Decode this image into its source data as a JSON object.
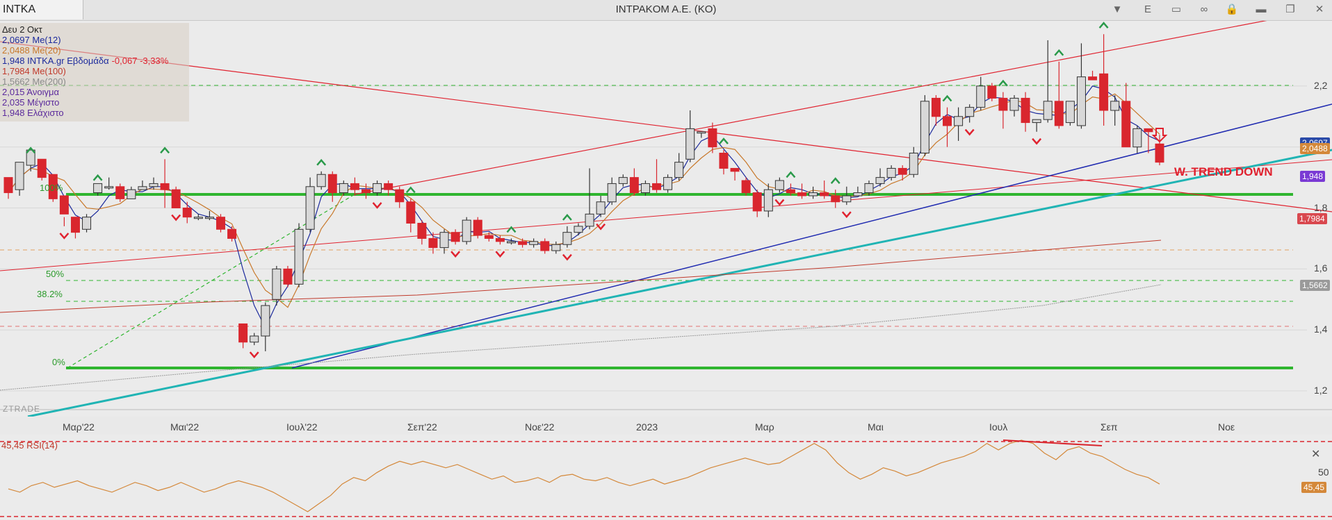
{
  "header": {
    "symbol": "INTKA",
    "title": "INTPAKOM A.E. (KO)",
    "period_button": "E"
  },
  "info": {
    "date": "Δευ 2 Οκτ",
    "lines": [
      {
        "text": "2,0697 Me(12)",
        "color": "#1c2a9c"
      },
      {
        "text": "2,0488 Me(20)",
        "color": "#c8782a"
      },
      {
        "text": "1,948 INTKA.gr Εβδομάδα",
        "color": "#1c2a9c",
        "extra": "-0,067 -3,33%",
        "extra_color": "#e0222f"
      },
      {
        "text": "1,7984 Me(100)",
        "color": "#c0392b"
      },
      {
        "text": "1,5662 Me(200)",
        "color": "#8a8a8a"
      },
      {
        "text": "2,015 Άνοιγμα",
        "color": "#5b2a9c"
      },
      {
        "text": "2,035 Μέγιστο",
        "color": "#5b2a9c"
      },
      {
        "text": "1,948 Ελάχιστο",
        "color": "#5b2a9c"
      }
    ]
  },
  "axis": {
    "x_ticks": [
      "Μαρ'22",
      "Μαι'22",
      "Ιουλ'22",
      "Σεπ'22",
      "Νοε'22",
      "2023",
      "Μαρ",
      "Μαι",
      "Ιουλ",
      "Σεπ",
      "Νοε"
    ],
    "y_ticks": [
      "2,2",
      "2",
      "1,8",
      "1,6",
      "1,4",
      "1,2"
    ],
    "rsi_tick": "50"
  },
  "price_tags": [
    {
      "text": "2,0697",
      "color": "#2a4aa8"
    },
    {
      "text": "2,0488",
      "color": "#d4883a"
    },
    {
      "text": "1,948",
      "color": "#7a3ad4"
    },
    {
      "text": "1,7984",
      "color": "#d9484f"
    },
    {
      "text": "1,5662",
      "color": "#9a9a9a"
    }
  ],
  "fib": [
    "100%",
    "50%",
    "38.2%",
    "0%"
  ],
  "annotation": "W. TREND DOWN",
  "watermark": "ZTRADE",
  "rsi": {
    "label": "45,45 RSI(14)",
    "value_tag": "45,45",
    "values": [
      42,
      40,
      44,
      46,
      43,
      45,
      47,
      44,
      42,
      40,
      43,
      46,
      44,
      41,
      43,
      46,
      43,
      40,
      42,
      45,
      47,
      45,
      43,
      40,
      36,
      32,
      28,
      33,
      38,
      45,
      49,
      47,
      52,
      56,
      59,
      57,
      59,
      57,
      55,
      57,
      54,
      51,
      48,
      50,
      46,
      47,
      49,
      46,
      50,
      51,
      48,
      47,
      49,
      46,
      44,
      46,
      48,
      45,
      47,
      49,
      52,
      55,
      57,
      59,
      61,
      59,
      57,
      58,
      62,
      66,
      70,
      66,
      58,
      52,
      48,
      51,
      55,
      53,
      50,
      52,
      55,
      58,
      60,
      62,
      65,
      70,
      66,
      70,
      72,
      70,
      64,
      60,
      66,
      68,
      64,
      62,
      58,
      54,
      51,
      49,
      45
    ]
  },
  "colors": {
    "bull": "#d8d8d8",
    "bear": "#d9262e",
    "ma12": "#1c2a9c",
    "ma20": "#c8782a",
    "ma100": "#c0392b",
    "ma200": "#9a9a9a",
    "fib": "#2fb52f",
    "teal": "#20b4b4"
  },
  "chart_data": {
    "type": "candlestick",
    "title": "INTPAKOM A.E. (KO)",
    "timeframe": "weekly",
    "dates_start": "Μαρ'22",
    "ylim": [
      1.15,
      2.35
    ],
    "candles": [
      [
        1.9,
        1.85,
        1.83,
        1.86
      ],
      [
        1.86,
        1.95,
        1.84,
        1.94
      ],
      [
        1.94,
        1.99,
        1.92,
        1.96
      ],
      [
        1.96,
        1.9,
        1.89,
        1.91
      ],
      [
        1.91,
        1.83,
        1.82,
        1.84
      ],
      [
        1.84,
        1.78,
        1.74,
        1.77
      ],
      [
        1.77,
        1.72,
        1.7,
        1.73
      ],
      [
        1.73,
        1.77,
        1.72,
        1.78
      ],
      [
        1.85,
        1.88,
        1.84,
        1.87
      ],
      [
        1.87,
        1.87,
        1.86,
        1.9
      ],
      [
        1.87,
        1.83,
        1.82,
        1.88
      ],
      [
        1.83,
        1.86,
        1.83,
        1.87
      ],
      [
        1.86,
        1.87,
        1.86,
        1.89
      ],
      [
        1.87,
        1.88,
        1.86,
        1.9
      ],
      [
        1.88,
        1.86,
        1.8,
        1.96
      ],
      [
        1.86,
        1.8,
        1.8,
        1.87
      ],
      [
        1.8,
        1.77,
        1.75,
        1.82
      ],
      [
        1.77,
        1.77,
        1.76,
        1.78
      ],
      [
        1.77,
        1.77,
        1.76,
        1.79
      ],
      [
        1.77,
        1.73,
        1.72,
        1.78
      ],
      [
        1.73,
        1.7,
        1.69,
        1.74
      ],
      [
        1.42,
        1.36,
        1.34,
        1.42
      ],
      [
        1.36,
        1.38,
        1.35,
        1.39
      ],
      [
        1.38,
        1.48,
        1.33,
        1.49
      ],
      [
        1.5,
        1.6,
        1.48,
        1.61
      ],
      [
        1.6,
        1.55,
        1.54,
        1.61
      ],
      [
        1.55,
        1.73,
        1.54,
        1.75
      ],
      [
        1.73,
        1.87,
        1.72,
        1.9
      ],
      [
        1.87,
        1.91,
        1.86,
        1.92
      ],
      [
        1.91,
        1.85,
        1.82,
        1.92
      ],
      [
        1.85,
        1.88,
        1.84,
        1.89
      ],
      [
        1.88,
        1.86,
        1.84,
        1.9
      ],
      [
        1.86,
        1.85,
        1.83,
        1.88
      ],
      [
        1.85,
        1.88,
        1.84,
        1.89
      ],
      [
        1.88,
        1.86,
        1.84,
        1.89
      ],
      [
        1.86,
        1.82,
        1.8,
        1.87
      ],
      [
        1.82,
        1.75,
        1.72,
        1.83
      ],
      [
        1.75,
        1.7,
        1.68,
        1.76
      ],
      [
        1.7,
        1.67,
        1.65,
        1.72
      ],
      [
        1.67,
        1.72,
        1.65,
        1.73
      ],
      [
        1.72,
        1.69,
        1.68,
        1.73
      ],
      [
        1.69,
        1.76,
        1.68,
        1.77
      ],
      [
        1.76,
        1.71,
        1.7,
        1.77
      ],
      [
        1.71,
        1.7,
        1.69,
        1.72
      ],
      [
        1.7,
        1.69,
        1.68,
        1.71
      ],
      [
        1.69,
        1.69,
        1.68,
        1.7
      ],
      [
        1.69,
        1.68,
        1.67,
        1.7
      ],
      [
        1.68,
        1.69,
        1.67,
        1.7
      ],
      [
        1.69,
        1.66,
        1.65,
        1.7
      ],
      [
        1.66,
        1.68,
        1.65,
        1.69
      ],
      [
        1.68,
        1.72,
        1.67,
        1.74
      ],
      [
        1.72,
        1.74,
        1.71,
        1.75
      ],
      [
        1.74,
        1.78,
        1.73,
        1.93
      ],
      [
        1.78,
        1.82,
        1.77,
        1.84
      ],
      [
        1.82,
        1.88,
        1.81,
        1.9
      ],
      [
        1.88,
        1.9,
        1.87,
        1.91
      ],
      [
        1.9,
        1.85,
        1.84,
        1.93
      ],
      [
        1.85,
        1.88,
        1.84,
        1.89
      ],
      [
        1.88,
        1.86,
        1.85,
        1.96
      ],
      [
        1.86,
        1.9,
        1.85,
        1.91
      ],
      [
        1.9,
        1.95,
        1.89,
        1.98
      ],
      [
        1.96,
        2.06,
        1.95,
        2.12
      ],
      [
        2.05,
        2.05,
        2.03,
        2.05
      ],
      [
        2.06,
        2.0,
        1.98,
        2.08
      ],
      [
        1.98,
        1.93,
        1.91,
        1.99
      ],
      [
        1.93,
        1.92,
        1.89,
        1.93
      ],
      [
        1.89,
        1.85,
        1.84,
        1.9
      ],
      [
        1.85,
        1.79,
        1.77,
        1.86
      ],
      [
        1.79,
        1.86,
        1.77,
        1.88
      ],
      [
        1.86,
        1.89,
        1.85,
        1.9
      ],
      [
        1.86,
        1.85,
        1.84,
        1.88
      ],
      [
        1.85,
        1.84,
        1.83,
        1.88
      ],
      [
        1.84,
        1.85,
        1.83,
        1.87
      ],
      [
        1.85,
        1.84,
        1.83,
        1.89
      ],
      [
        1.84,
        1.82,
        1.8,
        1.86
      ],
      [
        1.82,
        1.84,
        1.81,
        1.87
      ],
      [
        1.84,
        1.85,
        1.84,
        1.87
      ],
      [
        1.85,
        1.88,
        1.84,
        1.89
      ],
      [
        1.88,
        1.9,
        1.87,
        1.93
      ],
      [
        1.9,
        1.93,
        1.89,
        1.94
      ],
      [
        1.93,
        1.91,
        1.89,
        1.94
      ],
      [
        1.91,
        1.98,
        1.9,
        2.0
      ],
      [
        1.98,
        2.15,
        1.97,
        2.17
      ],
      [
        2.16,
        2.1,
        2.07,
        2.17
      ],
      [
        2.1,
        2.07,
        2.0,
        2.13
      ],
      [
        2.07,
        2.1,
        2.02,
        2.13
      ],
      [
        2.1,
        2.13,
        2.08,
        2.14
      ],
      [
        2.13,
        2.2,
        2.12,
        2.23
      ],
      [
        2.2,
        2.16,
        2.15,
        2.21
      ],
      [
        2.16,
        2.12,
        2.06,
        2.18
      ],
      [
        2.12,
        2.16,
        2.1,
        2.17
      ],
      [
        2.16,
        2.08,
        2.05,
        2.18
      ],
      [
        2.08,
        2.09,
        2.05,
        2.09
      ],
      [
        2.09,
        2.15,
        2.08,
        2.35
      ],
      [
        2.15,
        2.07,
        2.06,
        2.28
      ],
      [
        2.08,
        2.15,
        2.07,
        2.15
      ],
      [
        2.07,
        2.23,
        2.06,
        2.34
      ],
      [
        2.23,
        2.22,
        2.22,
        2.25
      ],
      [
        2.24,
        2.12,
        2.07,
        2.37
      ],
      [
        2.12,
        2.15,
        2.07,
        2.17
      ],
      [
        2.15,
        2.0,
        2.0,
        2.21
      ],
      [
        2.0,
        2.06,
        1.98,
        2.07
      ],
      [
        2.06,
        2.05,
        1.98,
        2.06
      ],
      [
        2.01,
        1.95,
        1.94,
        2.04
      ]
    ]
  }
}
